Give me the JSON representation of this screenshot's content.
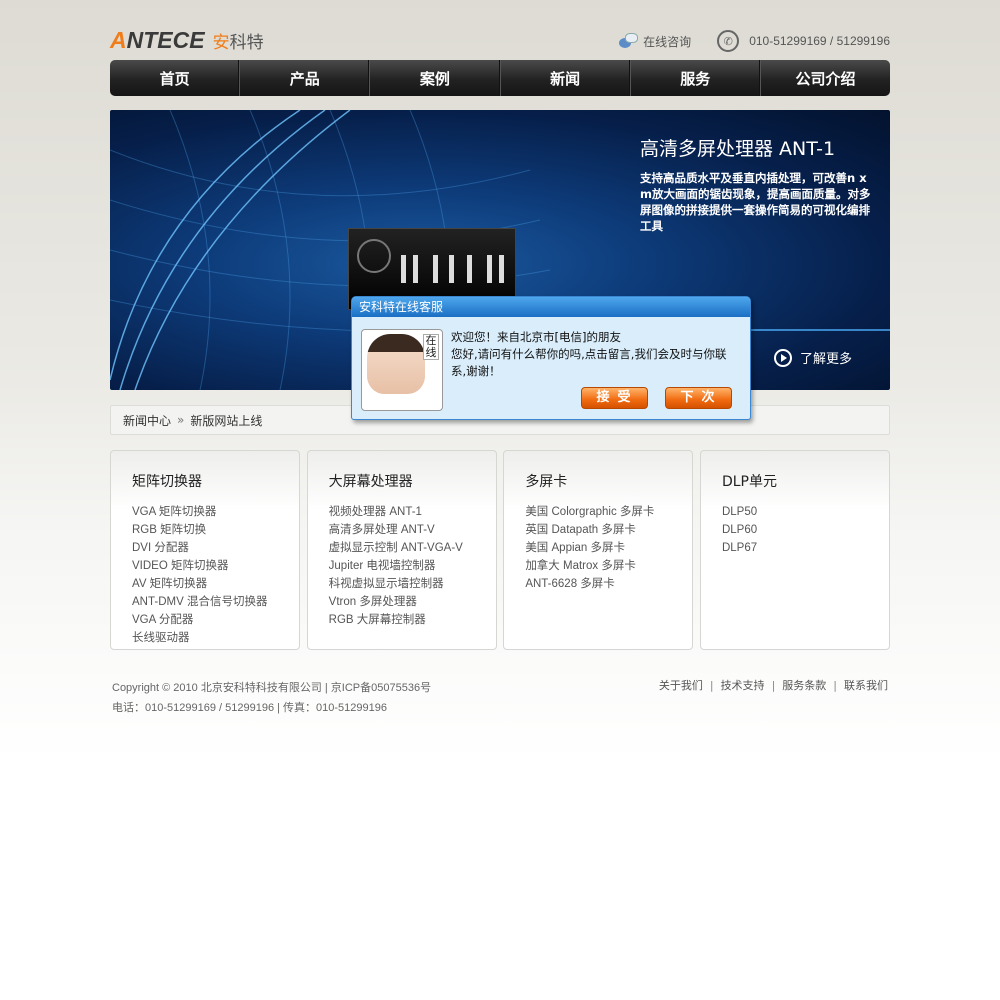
{
  "header": {
    "logo_en_accent": "A",
    "logo_en_rest": "NTECE",
    "logo_cn_accent": "安",
    "logo_cn_rest": "科特",
    "online_consult": "在线咨询",
    "phone": "010-51299169 / 51299196"
  },
  "nav": [
    "首页",
    "产品",
    "案例",
    "新闻",
    "服务",
    "公司介绍"
  ],
  "banner": {
    "title": "高清多屏处理器 ANT-1",
    "description": "支持高品质水平及垂直内插处理，可改善n x m放大画面的锯齿现象，提高画面质量。对多屏图像的拼接提供一套操作简易的可视化编排工具",
    "more": "了解更多"
  },
  "breadcrumb": {
    "section": "新闻中心",
    "separator": "»",
    "current": "新版网站上线"
  },
  "categories": [
    {
      "title": "矩阵切换器",
      "items": [
        "VGA 矩阵切换器",
        "RGB 矩阵切换",
        "DVI 分配器",
        "VIDEO 矩阵切换器",
        "AV 矩阵切换器",
        "ANT-DMV 混合信号切换器",
        "VGA 分配器",
        "长线驱动器"
      ]
    },
    {
      "title": "大屏幕处理器",
      "items": [
        "视频处理器 ANT-1",
        "高清多屏处理 ANT-V",
        "虚拟显示控制 ANT-VGA-V",
        "Jupiter 电视墙控制器",
        "科视虚拟显示墙控制器",
        "Vtron 多屏处理器",
        "RGB 大屏幕控制器"
      ]
    },
    {
      "title": "多屏卡",
      "items": [
        "美国 Colorgraphic 多屏卡",
        "英国 Datapath 多屏卡",
        "美国 Appian 多屏卡",
        "加拿大 Matrox 多屏卡",
        "ANT-6628 多屏卡"
      ]
    },
    {
      "title": "DLP单元",
      "items": [
        "DLP50",
        "DLP60",
        "DLP67"
      ]
    }
  ],
  "footer": {
    "copyright": "Copyright © 2010 北京安科特科技有限公司 | 京ICP备05075536号",
    "contact": "电话：010-51299169 / 51299196 | 传真：010-51299196",
    "links": [
      "关于我们",
      "技术支持",
      "服务条款",
      "联系我们"
    ],
    "link_separator": "|"
  },
  "chat": {
    "title": "安科特在线客服",
    "photo_label": "在线",
    "greeting": "欢迎您！来自北京市[电信]的朋友",
    "message": "您好,请问有什么帮你的吗,点击留言,我们会及时与你联系,谢谢！",
    "accept_button": "接受",
    "later_button": "下次"
  },
  "colors": {
    "accent": "#f07d1a",
    "nav_bg": "#222222",
    "chat_header": "#1a6fc4"
  },
  "icons": {
    "consult": "chat-bubbles-icon",
    "phone": "phone-icon",
    "more": "play-circle-icon"
  }
}
